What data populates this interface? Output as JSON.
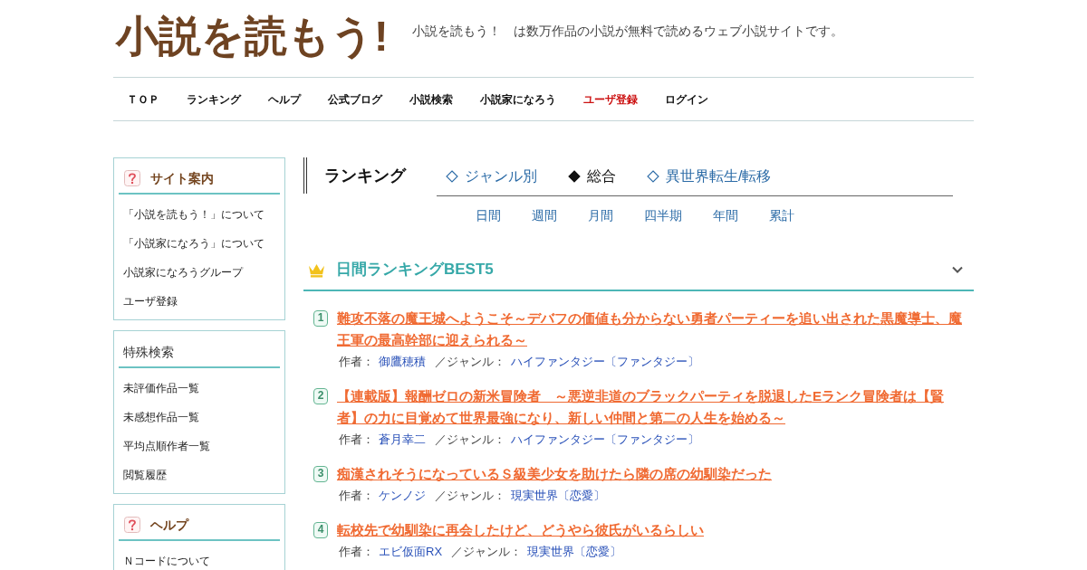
{
  "header": {
    "logo": "小説を読もう!",
    "tagline": "小説を読もう！　は数万作品の小説が無料で読めるウェブ小説サイトです。"
  },
  "nav": [
    {
      "label": "ＴＯＰ",
      "color": "#111111"
    },
    {
      "label": "ランキング",
      "color": "#111111"
    },
    {
      "label": "ヘルプ",
      "color": "#111111"
    },
    {
      "label": "公式ブログ",
      "color": "#111111"
    },
    {
      "label": "小説検索",
      "color": "#111111"
    },
    {
      "label": "小説家になろう",
      "color": "#111111"
    },
    {
      "label": "ユーザ登録",
      "color": "#cc1111"
    },
    {
      "label": "ログイン",
      "color": "#111111"
    }
  ],
  "sidebar": [
    {
      "kind": "guide",
      "title": "サイト案内",
      "items": [
        "「小説を読もう！」について",
        "「小説家になろう」について",
        "小説家になろうグループ",
        "ユーザ登録"
      ]
    },
    {
      "kind": "plain",
      "title": "特殊検索",
      "items": [
        "未評価作品一覧",
        "未感想作品一覧",
        "平均点順作者一覧",
        "閲覧履歴"
      ]
    },
    {
      "kind": "guide",
      "title": "ヘルプ",
      "items": [
        "Ｎコードについて"
      ]
    }
  ],
  "ranking": {
    "heading": "ランキング",
    "tabs": [
      {
        "label": "ジャンル別",
        "selected": false
      },
      {
        "label": "総合",
        "selected": true
      },
      {
        "label": "異世界転生/転移",
        "selected": false
      }
    ],
    "periods": [
      "日間",
      "週間",
      "月間",
      "四半期",
      "年間",
      "累計"
    ],
    "section_title": "日間ランキングBEST5",
    "entries": [
      {
        "rank": "1",
        "title": "難攻不落の魔王城へようこそ～デバフの価値も分からない勇者パーティーを追い出された黒魔導士、魔王軍の最高幹部に迎えられる～",
        "author_label": "作者：",
        "author": "御鷹穂積",
        "genre_label": "／ジャンル：",
        "genre": "ハイファンタジー〔ファンタジー〕"
      },
      {
        "rank": "2",
        "title": "【連載版】報酬ゼロの新米冒険者　～悪逆非道のブラックパーティを脱退したEランク冒険者は【賢者】の力に目覚めて世界最強になり、新しい仲間と第二の人生を始める～",
        "author_label": "作者：",
        "author": "蒼月幸二",
        "genre_label": "／ジャンル：",
        "genre": "ハイファンタジー〔ファンタジー〕"
      },
      {
        "rank": "3",
        "title": "痴漢されそうになっているＳ級美少女を助けたら隣の席の幼馴染だった",
        "author_label": "作者：",
        "author": "ケンノジ",
        "genre_label": "／ジャンル：",
        "genre": "現実世界〔恋愛〕"
      },
      {
        "rank": "4",
        "title": "転校先で幼馴染に再会したけど、どうやら彼氏がいるらしい",
        "author_label": "作者：",
        "author": "エビ仮面RX",
        "genre_label": "／ジャンル：",
        "genre": "現実世界〔恋愛〕"
      }
    ]
  }
}
